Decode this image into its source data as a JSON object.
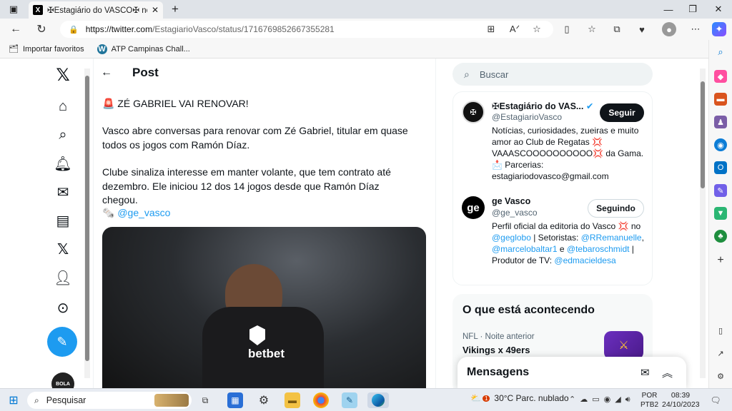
{
  "browser": {
    "tab_title": "✠Estagiário do VASCO✠ no X: \"🚨",
    "url_host": "https://twitter.com",
    "url_path": "/EstagiarioVasco/status/1716769852667355281",
    "favorites": [
      {
        "label": "Importar favoritos",
        "icon": "folder-import-icon"
      },
      {
        "label": "ATP Campinas Chall...",
        "icon": "wordpress-icon"
      }
    ]
  },
  "post": {
    "header": "Post",
    "line1": "🚨 ZÉ GABRIEL VAI RENOVAR!",
    "para1": "Vasco abre conversas para renovar com Zé Gabriel, titular em quase todos os jogos com Ramón Díaz.",
    "para2": "Clube sinaliza interesse em manter volante, que tem contrato até dezembro. Ele iniciou 12 dos 14 jogos desde que Ramón Díaz chegou.",
    "source_emoji": "🗞️",
    "source_link": "@ge_vasco",
    "photo_text": "betbet"
  },
  "search": {
    "placeholder": "Buscar"
  },
  "who_to_follow": [
    {
      "name": "✠Estagiário do VAS...",
      "handle": "@EstagiarioVasco",
      "bio": "Notícias, curiosidades, zueiras e muito amor ao Club de Regatas 💢 VAAASCOOOOOOOOOO💢 da Gama. 📩 Parcerias: estagiariodovasco@gmail.com",
      "button": "Seguir",
      "verified": true
    },
    {
      "name": "ge Vasco",
      "handle": "@ge_vasco",
      "bio_prefix": "Perfil oficial da editoria do Vasco 💢 no ",
      "bio_link1": "@geglobo",
      "bio_mid": " | Setoristas: ",
      "bio_link2": "@RRemanuelle",
      "bio_comma": ", ",
      "bio_link3": "@marcelobaltar1",
      "bio_and": " e ",
      "bio_link4": "@tebaroschmidt",
      "bio_mid2": " | Produtor de TV: ",
      "bio_link5": "@edmacieldesa",
      "button": "Seguindo",
      "avatar_text": "ge"
    }
  ],
  "trends": {
    "heading": "O que está acontecendo",
    "item_meta": "NFL · Noite anterior",
    "item_title": "Vikings x 49ers"
  },
  "messages": {
    "label": "Mensagens"
  },
  "taskbar": {
    "search_label": "Pesquisar",
    "weather": "30°C  Parc. nublado",
    "lang1": "POR",
    "lang2": "PTB2",
    "time": "08:39",
    "date": "24/10/2023",
    "notification_count": "1"
  },
  "avatar_label": "BOLA"
}
